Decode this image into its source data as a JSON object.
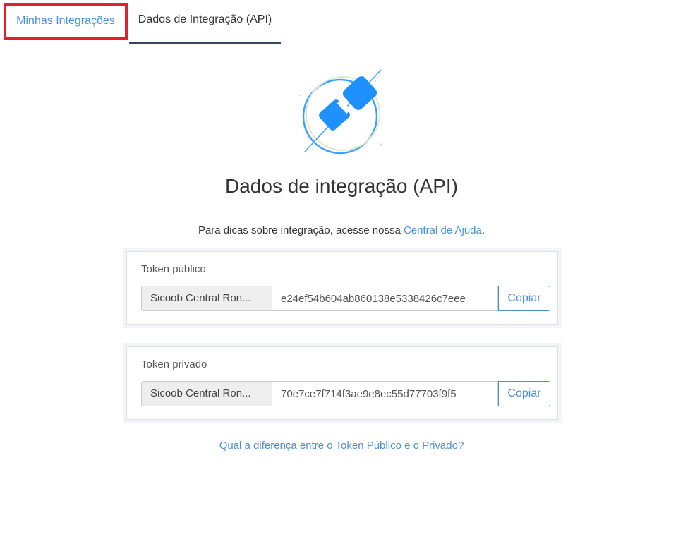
{
  "tabs": [
    {
      "label": "Minhas Integrações"
    },
    {
      "label": "Dados de Integração (API)"
    }
  ],
  "main": {
    "title": "Dados de integração (API)",
    "help_text": "Para dicas sobre integração, acesse nossa ",
    "help_link": "Central de Ajuda",
    "help_suffix": ".",
    "diff_link": "Qual a diferença entre o Token Público e o Privado?"
  },
  "tokens": {
    "public": {
      "label": "Token público",
      "account": "Sicoob Central Ron...",
      "value": "e24ef54b604ab860138e5338426c7eee",
      "copy_label": "Copiar"
    },
    "private": {
      "label": "Token privado",
      "account": "Sicoob Central Ron...",
      "value": "70e7ce7f714f3ae9e8ec55d77703f9f5",
      "copy_label": "Copiar"
    }
  },
  "icons": {
    "hero": "plug-connection-icon"
  },
  "colors": {
    "accent": "#4a90d9",
    "icon_blue": "#1e90ff",
    "active_tab_underline": "#34495e",
    "highlight_border": "#e0202a"
  }
}
